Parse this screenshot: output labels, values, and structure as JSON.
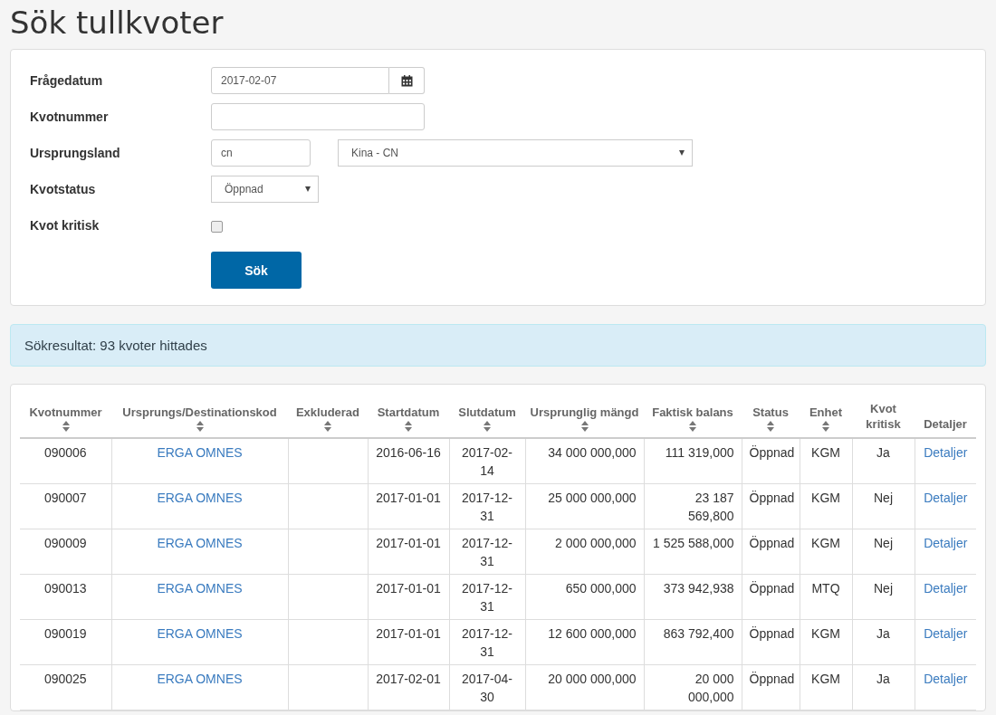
{
  "title": "Sök tullkvoter",
  "form": {
    "fields": [
      {
        "kind": "date",
        "label": "Frågedatum",
        "value": "2017-02-07"
      },
      {
        "kind": "text",
        "label": "Kvotnummer"
      },
      {
        "kind": "country",
        "label": "Ursprungsland",
        "value": "cn",
        "select": "Kina - CN"
      },
      {
        "kind": "select",
        "label": "Kvotstatus",
        "select": "Öppnad"
      },
      {
        "kind": "checkbox",
        "label": "Kvot kritisk",
        "checked": false
      }
    ],
    "submit": "Sök"
  },
  "result_alert": "Sökresultat: 93 kvoter hittades",
  "table": {
    "columns": [
      {
        "label": "Kvotnummer",
        "sortable": true
      },
      {
        "label": "Ursprungs/Destinationskod",
        "sortable": true
      },
      {
        "label": "Exkluderad",
        "sortable": true
      },
      {
        "label": "Startdatum",
        "sortable": true
      },
      {
        "label": "Slutdatum",
        "sortable": true
      },
      {
        "label": "Ursprunglig mängd",
        "sortable": true
      },
      {
        "label": "Faktisk balans",
        "sortable": true
      },
      {
        "label": "Status",
        "sortable": true
      },
      {
        "label": "Enhet",
        "sortable": true
      },
      {
        "label": "Kvot kritisk",
        "sortable": false
      },
      {
        "label": "Detaljer",
        "sortable": false
      }
    ],
    "rows": [
      {
        "number": "090006",
        "origin": "ERGA OMNES",
        "start": "2016-06-16",
        "end": "2017-02-14",
        "original": "34 000 000,000",
        "balance": "111 319,000",
        "status": "Öppnad",
        "unit": "KGM",
        "critical": "Ja",
        "details": "Detaljer"
      },
      {
        "number": "090007",
        "origin": "ERGA OMNES",
        "start": "2017-01-01",
        "end": "2017-12-31",
        "original": "25 000 000,000",
        "balance": "23 187 569,800",
        "status": "Öppnad",
        "unit": "KGM",
        "critical": "Nej",
        "details": "Detaljer"
      },
      {
        "number": "090009",
        "origin": "ERGA OMNES",
        "start": "2017-01-01",
        "end": "2017-12-31",
        "original": "2 000 000,000",
        "balance": "1 525 588,000",
        "status": "Öppnad",
        "unit": "KGM",
        "critical": "Nej",
        "details": "Detaljer"
      },
      {
        "number": "090013",
        "origin": "ERGA OMNES",
        "start": "2017-01-01",
        "end": "2017-12-31",
        "original": "650 000,000",
        "balance": "373 942,938",
        "status": "Öppnad",
        "unit": "MTQ",
        "critical": "Nej",
        "details": "Detaljer"
      },
      {
        "number": "090019",
        "origin": "ERGA OMNES",
        "start": "2017-01-01",
        "end": "2017-12-31",
        "original": "12 600 000,000",
        "balance": "863 792,400",
        "status": "Öppnad",
        "unit": "KGM",
        "critical": "Ja",
        "details": "Detaljer"
      },
      {
        "number": "090025",
        "origin": "ERGA OMNES",
        "start": "2017-02-01",
        "end": "2017-04-30",
        "original": "20 000 000,000",
        "balance": "20 000 000,000",
        "status": "Öppnad",
        "unit": "KGM",
        "critical": "Ja",
        "details": "Detaljer"
      }
    ]
  }
}
